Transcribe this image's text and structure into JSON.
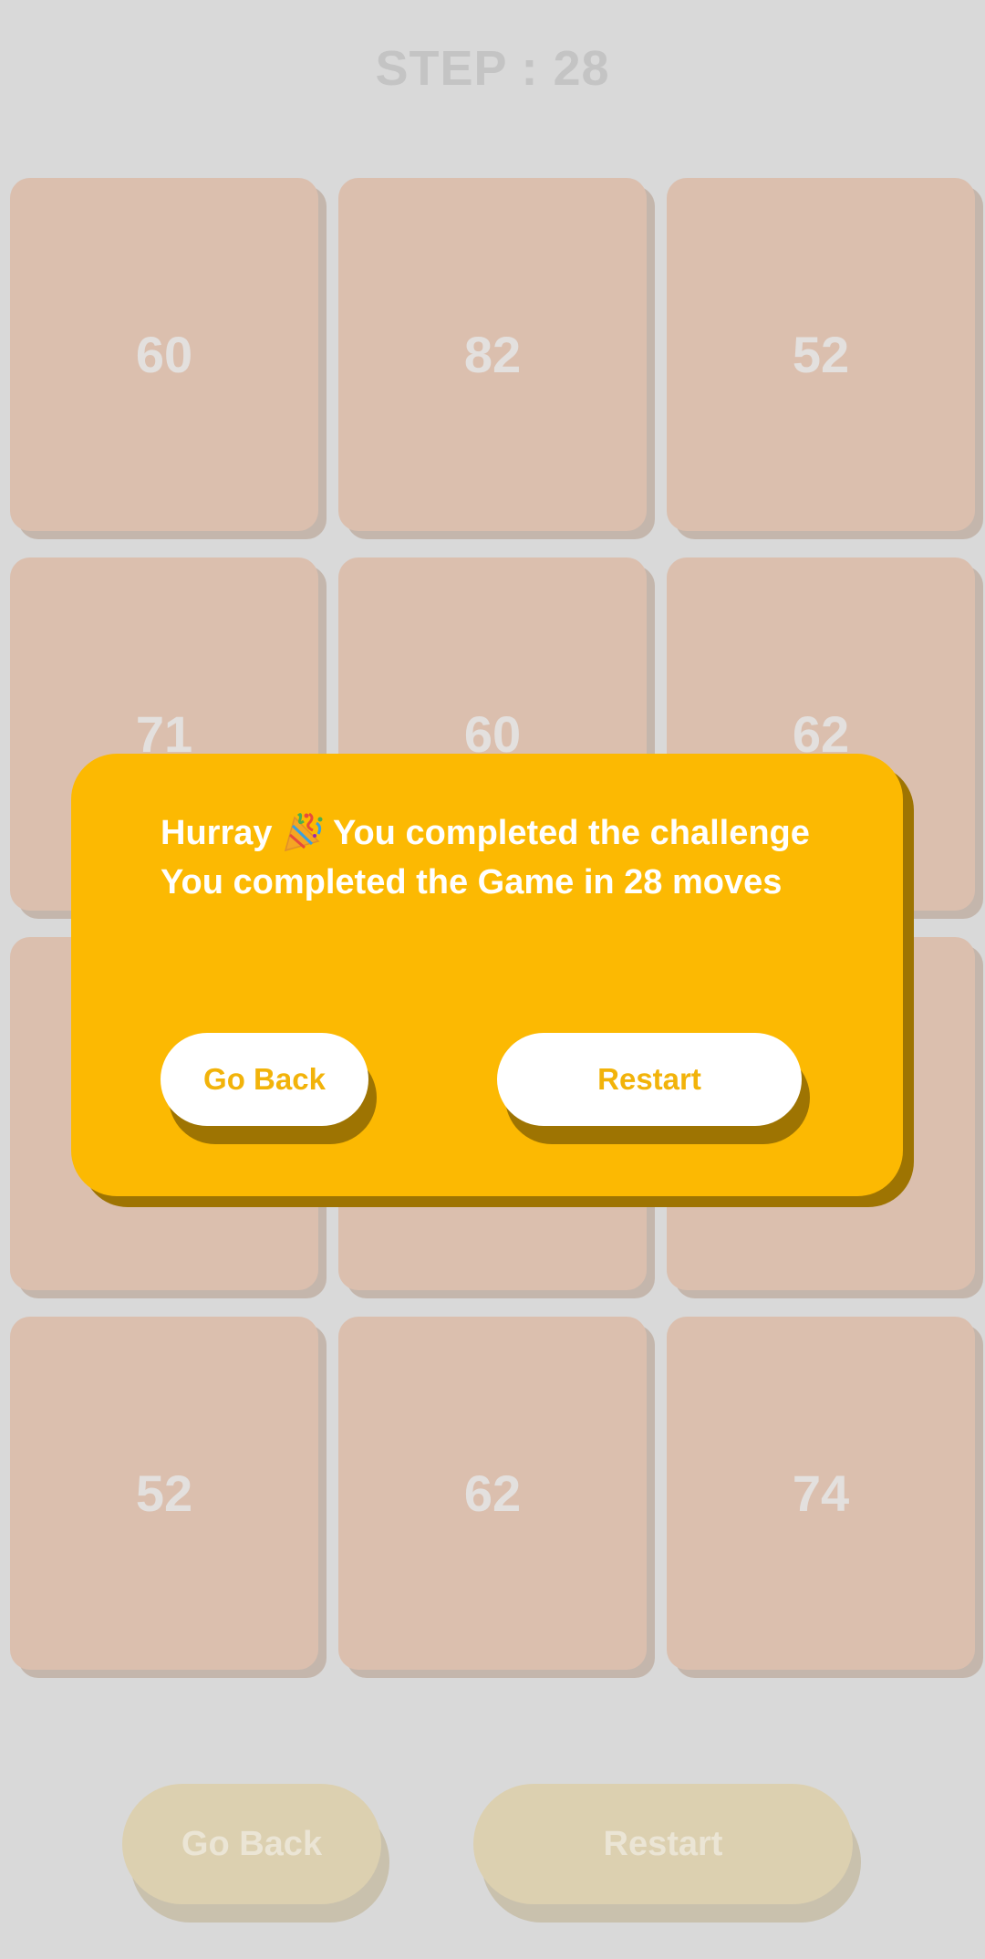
{
  "header": {
    "step_text": "STEP : 28"
  },
  "tiles": [
    "60",
    "82",
    "52",
    "71",
    "60",
    "62",
    "",
    "",
    "",
    "52",
    "62",
    "74"
  ],
  "bottom_bar": {
    "go_back_label": "Go Back",
    "restart_label": "Restart"
  },
  "dialog": {
    "line1_prefix": "Hurray",
    "line1_suffix": "You completed the challenge",
    "line2": "You completed the Game in 28 moves",
    "go_back_label": "Go Back",
    "restart_label": "Restart",
    "icon": "party-popper-icon"
  },
  "colors": {
    "background": "#d9d9d9",
    "tile": "#dbbfae",
    "dialog": "#fcb902",
    "dialog_shadow": "#9e7402",
    "button_text": "#f2b30a"
  }
}
